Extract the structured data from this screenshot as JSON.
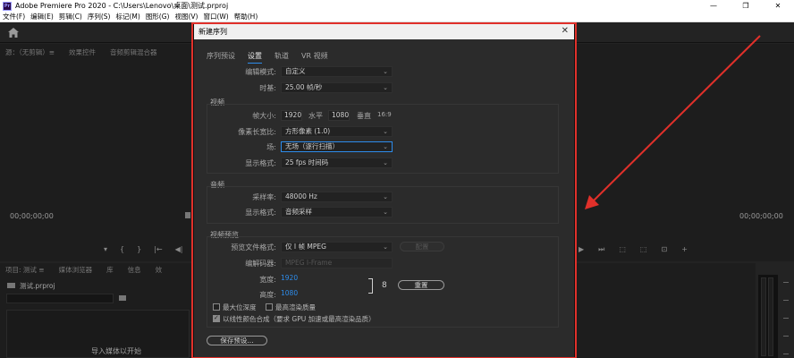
{
  "window": {
    "app_logo": "Pr",
    "title": "Adobe Premiere Pro 2020 - C:\\Users\\Lenovo\\桌面\\测试.prproj",
    "minimize": "—",
    "restore": "❐",
    "close": "✕"
  },
  "menu": [
    "文件(F)",
    "编辑(E)",
    "剪辑(C)",
    "序列(S)",
    "标记(M)",
    "图形(G)",
    "视图(V)",
    "窗口(W)",
    "帮助(H)"
  ],
  "source_panel": {
    "tabs": [
      "源：（无剪辑）≡",
      "效果控件",
      "音频剪辑混合器"
    ],
    "timecode": "00;00;00;00"
  },
  "program_panel": {
    "timecode": "00;00;00;00",
    "transport_icons": [
      "▶",
      "⏭",
      "⬚",
      "⬚",
      "⊡",
      "+"
    ]
  },
  "source_transport": [
    "▾",
    "{",
    "}",
    "|←",
    "◀|"
  ],
  "project_panel": {
    "tabs": [
      "项目: 测试 ≡",
      "媒体浏览器",
      "库",
      "信息",
      "效"
    ],
    "project_file": "测试.prproj",
    "import_hint": "导入媒体以开始"
  },
  "dialog": {
    "title": "新建序列",
    "close": "✕",
    "tabs": [
      "序列预设",
      "设置",
      "轨道",
      "VR 视频"
    ],
    "active_tab": "设置",
    "edit_mode": {
      "label": "编辑模式:",
      "value": "自定义"
    },
    "timebase": {
      "label": "时基:",
      "value": "25.00  帧/秒"
    },
    "video_group": {
      "title": "视频",
      "frame_size_label": "帧大小:",
      "frame_width": "1920",
      "horizontal_label": "水平",
      "frame_height": "1080",
      "vertical_label": "垂直",
      "ratio": "16:9",
      "pixel_aspect": {
        "label": "像素长宽比:",
        "value": "方形像素 (1.0)"
      },
      "field": {
        "label": "场:",
        "value": "无场（逐行扫描）"
      },
      "display_format": {
        "label": "显示格式:",
        "value": "25 fps 时间码"
      }
    },
    "audio_group": {
      "title": "音频",
      "sample_rate": {
        "label": "采样率:",
        "value": "48000 Hz"
      },
      "display_format": {
        "label": "显示格式:",
        "value": "音频采样"
      }
    },
    "preview_group": {
      "title": "视频预览",
      "preview_format": {
        "label": "预览文件格式:",
        "value": "仅 I 帧 MPEG"
      },
      "config_button": "配置",
      "codec": {
        "label": "编解码器:",
        "value": "MPEG I-Frame"
      },
      "width_label": "宽度:",
      "width_value": "1920",
      "height_label": "高度:",
      "height_value": "1080",
      "link_icon": "8",
      "reset_button": "重置",
      "max_bit_depth": {
        "label": "最大位深度",
        "checked": false
      },
      "max_render_quality": {
        "label": "最高渲染质量",
        "checked": false
      },
      "linear_color": {
        "label": "以线性颜色合成（要求 GPU 加速或最高渲染品质）",
        "checked": true
      }
    },
    "save_preset_button": "保存预设..."
  },
  "annotation_color": "#e0302a",
  "accent_color": "#2d8ceb"
}
